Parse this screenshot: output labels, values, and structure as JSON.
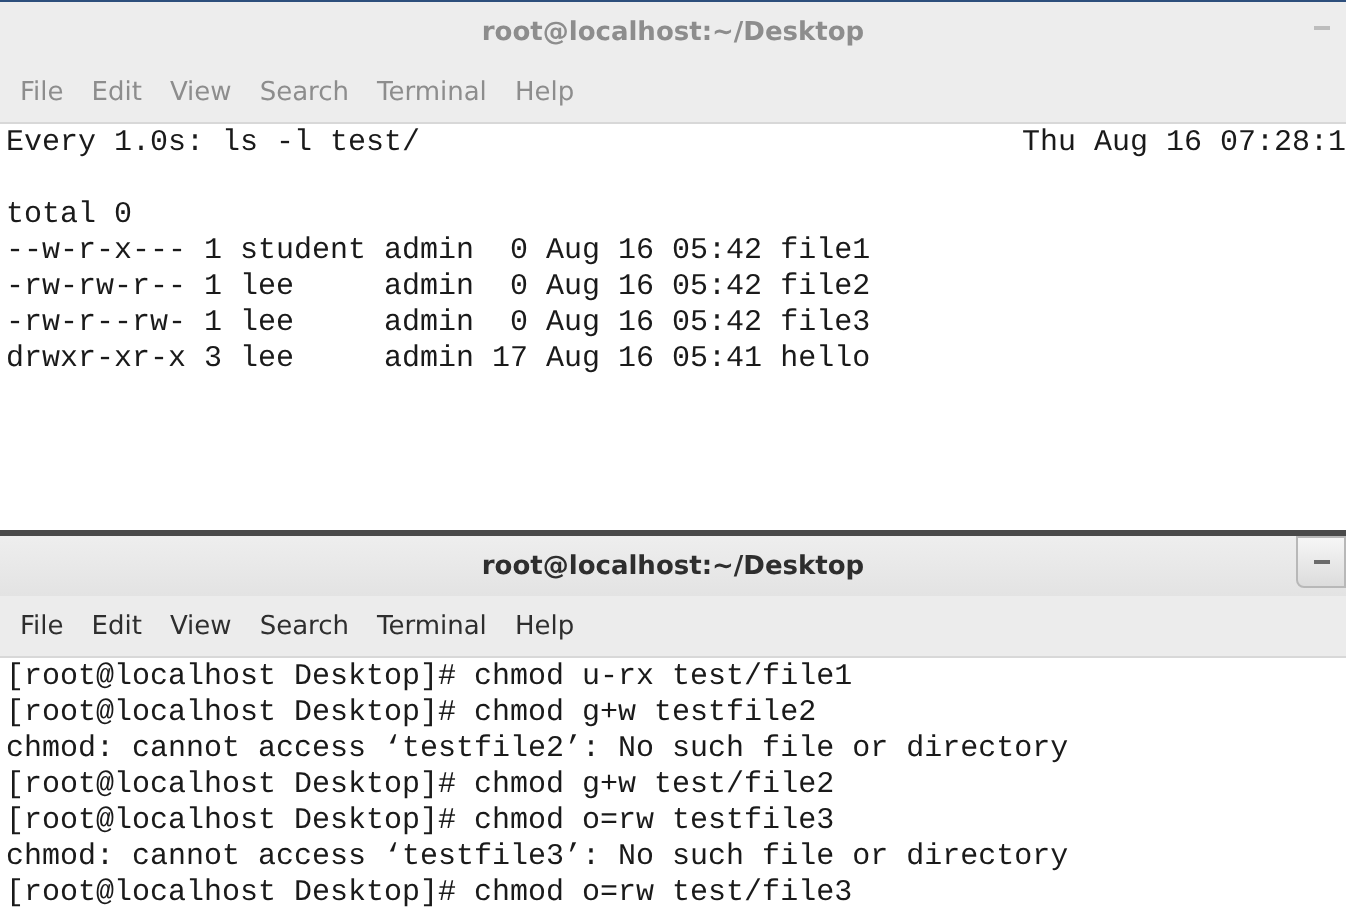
{
  "windows": [
    {
      "title": "root@localhost:~/Desktop",
      "active": false,
      "menu": [
        "File",
        "Edit",
        "View",
        "Search",
        "Terminal",
        "Help"
      ],
      "lines": [
        {
          "kind": "header",
          "text": "Every 1.0s: ls -l test/",
          "right": "Thu Aug 16 07:28:1"
        },
        {
          "kind": "blank"
        },
        {
          "kind": "text",
          "text": "total 0"
        },
        {
          "kind": "text",
          "text": "--w-r-x--- 1 student admin  0 Aug 16 05:42 file1"
        },
        {
          "kind": "text",
          "text": "-rw-rw-r-- 1 lee     admin  0 Aug 16 05:42 file2"
        },
        {
          "kind": "text",
          "text": "-rw-r--rw- 1 lee     admin  0 Aug 16 05:42 file3"
        },
        {
          "kind": "text",
          "text": "drwxr-xr-x 3 lee     admin 17 Aug 16 05:41 hello"
        }
      ]
    },
    {
      "title": "root@localhost:~/Desktop",
      "active": true,
      "menu": [
        "File",
        "Edit",
        "View",
        "Search",
        "Terminal",
        "Help"
      ],
      "lines": [
        {
          "kind": "text",
          "text": "[root@localhost Desktop]# chmod u-rx test/file1"
        },
        {
          "kind": "text",
          "text": "[root@localhost Desktop]# chmod g+w testfile2"
        },
        {
          "kind": "text",
          "text": "chmod: cannot access ‘testfile2’: No such file or directory"
        },
        {
          "kind": "text",
          "text": "[root@localhost Desktop]# chmod g+w test/file2"
        },
        {
          "kind": "text",
          "text": "[root@localhost Desktop]# chmod o=rw testfile3"
        },
        {
          "kind": "text",
          "text": "chmod: cannot access ‘testfile3’: No such file or directory"
        },
        {
          "kind": "text",
          "text": "[root@localhost Desktop]# chmod o=rw test/file3"
        }
      ]
    }
  ]
}
